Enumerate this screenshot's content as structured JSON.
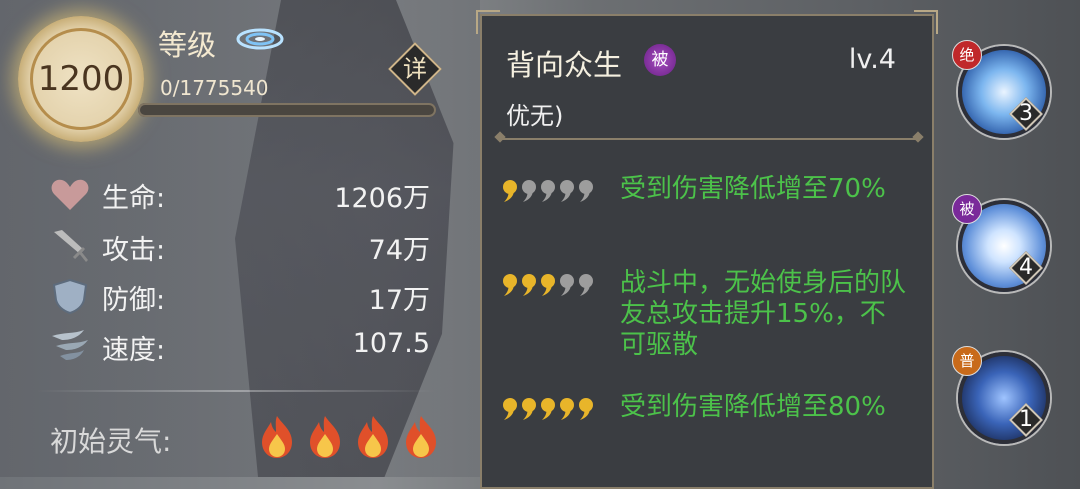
{
  "player": {
    "level": "1200",
    "level_label": "等级",
    "exp_text": "0/1775540",
    "exp_progress": 0.0,
    "detail_label": "详"
  },
  "stats": [
    {
      "label": "生命:",
      "value": "1206万",
      "icon": "heart-icon"
    },
    {
      "label": "攻击:",
      "value": "74万",
      "icon": "sword-icon"
    },
    {
      "label": "防御:",
      "value": "17万",
      "icon": "shield-icon"
    },
    {
      "label": "速度:",
      "value": "107.5",
      "icon": "wind-icon"
    }
  ],
  "aura": {
    "label": "初始灵气:",
    "count": 4,
    "color": "#e0502a"
  },
  "skill_tooltip": {
    "name": "背向众生",
    "type_badge": "被",
    "level": "lv.4",
    "owner": "优无)",
    "tiers": [
      {
        "filled": 1,
        "total": 5,
        "text": "受到伤害降低增至70%"
      },
      {
        "filled": 3,
        "total": 5,
        "text": "战斗中，无始使身后的队友总攻击提升15%，不可驱散"
      },
      {
        "filled": 5,
        "total": 5,
        "text": "受到伤害降低增至80%"
      }
    ],
    "text_color": "#4cc24a"
  },
  "skill_slots": [
    {
      "tag": "绝",
      "tag_color": "#c0282a",
      "level": "3"
    },
    {
      "tag": "被",
      "tag_color": "#7a2a9a",
      "level": "4"
    },
    {
      "tag": "普",
      "tag_color": "#c86a1a",
      "level": "1"
    }
  ]
}
